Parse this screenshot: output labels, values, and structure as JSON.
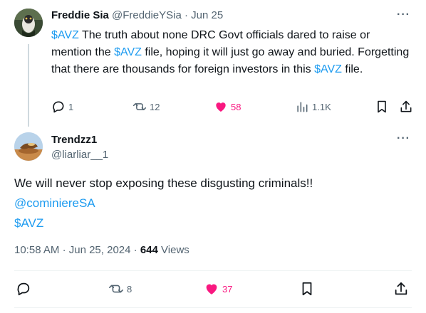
{
  "parent_tweet": {
    "display_name": "Freddie Sia",
    "handle": "@FreddieYSia",
    "separator": "·",
    "date": "Jun 25",
    "body": {
      "cashtag_1": "$AVZ",
      "text_1": " The truth about none DRC Govt officials dared to raise or mention the ",
      "cashtag_2": "$AVZ",
      "text_2": " file, hoping it will just go away and buried. Forgetting that there are thousands for foreign investors in this ",
      "cashtag_3": "$AVZ",
      "text_3": " file."
    },
    "actions": {
      "replies": "1",
      "reposts": "12",
      "likes": "58",
      "views": "1.1K"
    }
  },
  "reply_tweet": {
    "display_name": "Trendzz1",
    "handle": "@liarliar__1",
    "body_line_1": "We will never stop exposing these disgusting criminals!!",
    "mention": "@cominiereSA",
    "cashtag": "$AVZ",
    "meta": {
      "time": "10:58 AM",
      "sep_1": "·",
      "date": "Jun 25, 2024",
      "sep_2": "·",
      "views_count": "644",
      "views_label": "Views"
    },
    "actions": {
      "reposts": "8",
      "likes": "37"
    }
  },
  "more_label": "···",
  "colors": {
    "accent": "#1d9bf0",
    "like": "#f91880",
    "muted": "#536471"
  },
  "icons": [
    "more-icon",
    "reply-icon",
    "repost-icon",
    "like-icon-filled",
    "views-icon",
    "bookmark-icon",
    "share-icon"
  ]
}
